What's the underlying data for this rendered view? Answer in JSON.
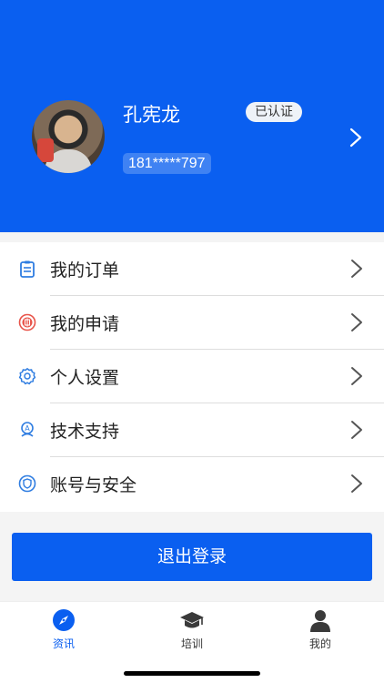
{
  "profile": {
    "name": "孔宪龙",
    "verified_badge": "已认证",
    "phone": "181*****797"
  },
  "menu": {
    "items": [
      {
        "label": "我的订单",
        "icon": "order-clipboard-icon"
      },
      {
        "label": "我的申请",
        "icon": "application-seal-icon"
      },
      {
        "label": "个人设置",
        "icon": "settings-gear-icon"
      },
      {
        "label": "技术支持",
        "icon": "support-person-icon"
      },
      {
        "label": "账号与安全",
        "icon": "security-shield-icon"
      }
    ]
  },
  "actions": {
    "logout_label": "退出登录"
  },
  "tabbar": {
    "tabs": [
      {
        "label": "资讯",
        "icon": "compass-icon",
        "active": true
      },
      {
        "label": "培训",
        "icon": "graduation-cap-icon",
        "active": false
      },
      {
        "label": "我的",
        "icon": "user-profile-icon",
        "active": false
      }
    ]
  },
  "colors": {
    "primary": "#0a5ff0",
    "icon_blue": "#2f7de1",
    "icon_red": "#e8544a"
  }
}
